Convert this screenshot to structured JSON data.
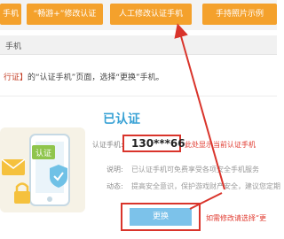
{
  "tabs": [
    {
      "label": "手机"
    },
    {
      "label": "“畅游+”修改认证"
    },
    {
      "label": "人工修改认证手机"
    },
    {
      "label": "手持照片示例"
    }
  ],
  "breadcrumb": {
    "text": "手机"
  },
  "instruction": {
    "link_text": "行证】",
    "rest_text": "的“认证手机”页面，选择“更换”手机。"
  },
  "status": {
    "title": "已认证",
    "phone_label": "认证手机:",
    "phone_value": "130***66",
    "phone_note": "此处显示当前认证手机",
    "desc_label": "说明:",
    "desc_text": "已认证手机可免费享受各项安全手机服务",
    "tip_label": "动态:",
    "tip_text": "提高安全意识，保护游戏财产安全，建议您定期"
  },
  "action": {
    "change_label": "更换",
    "change_note": "如需修改请选择“更"
  },
  "illustration": {
    "badge_text": "认证"
  },
  "colors": {
    "tab_bg": "#f4a12c",
    "accent_blue": "#39a2d5",
    "button_blue": "#7cc2ea",
    "annotation_red": "#d9342b"
  }
}
